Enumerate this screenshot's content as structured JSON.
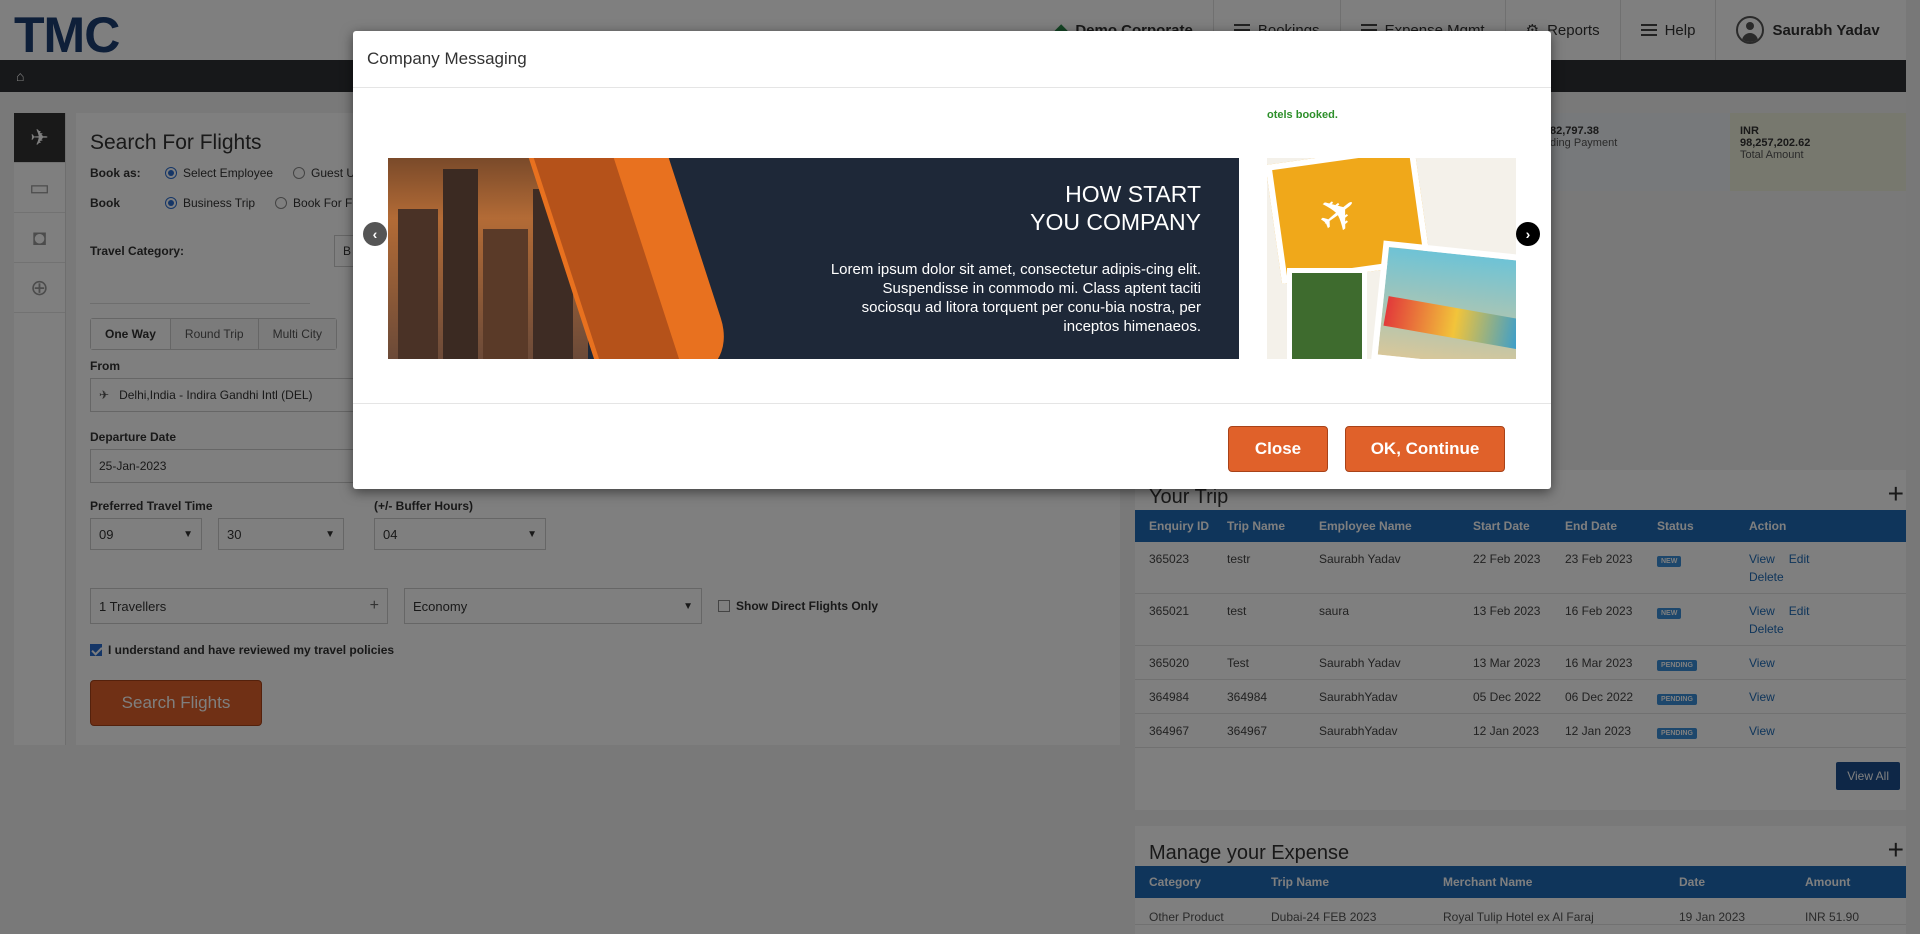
{
  "header": {
    "logo": "TMC",
    "corporate": "Demo Corporate",
    "nav": [
      "Bookings",
      "Expense Mgmt",
      "Reports",
      "Help"
    ],
    "user": "Saurabh Yadav"
  },
  "search": {
    "title": "Search For Flights",
    "book_as_label": "Book as:",
    "book_as_options": [
      "Select Employee",
      "Guest U"
    ],
    "book_label": "Book",
    "book_options": [
      "Business Trip",
      "Book For F"
    ],
    "travel_category_label": "Travel Category:",
    "travel_category_value": "B",
    "tabs": [
      "One Way",
      "Round Trip",
      "Multi City"
    ],
    "from_label": "From",
    "from_value": "Delhi,India - Indira Gandhi Intl (DEL)",
    "departure_label": "Departure Date",
    "departure_value": "25-Jan-2023",
    "time_label": "Preferred Travel Time",
    "buffer_label": "(+/- Buffer Hours)",
    "hour": "09",
    "minute": "30",
    "buffer": "04",
    "travellers": "1 Travellers",
    "cabin": "Economy",
    "direct_only": "Show Direct Flights Only",
    "policy": "I understand and have reviewed my travel policies",
    "button": "Search Flights"
  },
  "stats": [
    {
      "value": "82,797.38",
      "label": "ding Payment"
    },
    {
      "currency": "INR",
      "value": "98,257,202.62",
      "label": "Total Amount"
    }
  ],
  "trips": {
    "title": "Your Trip",
    "headers": [
      "Enquiry ID",
      "Trip Name",
      "Employee Name",
      "Start Date",
      "End Date",
      "Status",
      "Action"
    ],
    "rows": [
      {
        "id": "365023",
        "name": "testr",
        "emp": "Saurabh Yadav",
        "start": "22 Feb 2023",
        "end": "23 Feb 2023",
        "status": "NEW",
        "a1": "View",
        "a2": "Edit",
        "a3": "Delete"
      },
      {
        "id": "365021",
        "name": "test",
        "emp": "saura",
        "start": "13 Feb 2023",
        "end": "16 Feb 2023",
        "status": "NEW",
        "a1": "View",
        "a2": "Edit",
        "a3": "Delete"
      },
      {
        "id": "365020",
        "name": "Test",
        "emp": "Saurabh Yadav",
        "start": "13 Mar 2023",
        "end": "16 Mar 2023",
        "status": "PENDING",
        "a1": "View"
      },
      {
        "id": "364984",
        "name": "364984",
        "emp": "SaurabhYadav",
        "start": "05 Dec 2022",
        "end": "06 Dec 2022",
        "status": "PENDING",
        "a1": "View"
      },
      {
        "id": "364967",
        "name": "364967",
        "emp": "SaurabhYadav",
        "start": "12 Jan 2023",
        "end": "12 Jan 2023",
        "status": "PENDING",
        "a1": "View"
      }
    ],
    "view_all": "View All"
  },
  "expense": {
    "title": "Manage your Expense",
    "headers": [
      "Category",
      "Trip Name",
      "Merchant Name",
      "Date",
      "Amount"
    ],
    "row": [
      "Other Product",
      "Dubai-24 FEB 2023",
      "Royal Tulip Hotel ex Al Faraj",
      "19 Jan 2023",
      "INR 51.90"
    ]
  },
  "modal": {
    "title": "Company Messaging",
    "green_text": "otels booked.",
    "slide_title_1": "HOW START",
    "slide_title_2": "YOU COMPANY",
    "slide_text": "Lorem ipsum dolor sit amet, consectetur adipis-cing elit. Suspendisse in commodo mi. Class aptent taciti sociosqu ad litora torquent per conu-bia nostra, per inceptos himenaeos.",
    "close": "Close",
    "ok": "OK, Continue"
  },
  "colors": {
    "accent": "#e0612a",
    "brand": "#1c3e73",
    "table_head": "#1f6bb6"
  }
}
